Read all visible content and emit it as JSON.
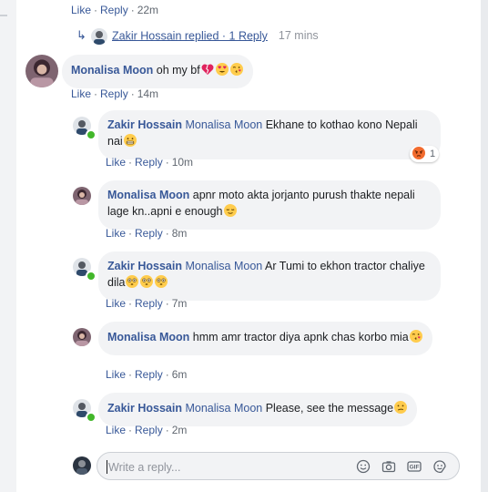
{
  "actions": {
    "like": "Like",
    "reply": "Reply",
    "sep": "·"
  },
  "top_row": {
    "time": "22m"
  },
  "reply_summary": {
    "text": "Zakir Hossain replied · 1 Reply",
    "time": "17 mins"
  },
  "comments": [
    {
      "id": "c1",
      "author": "Monalisa Moon",
      "mention": "",
      "text": "oh my bf",
      "time": "14m",
      "emojis": [
        "broken-heart",
        "heart-eyes",
        "kissing-face"
      ]
    },
    {
      "id": "r1",
      "author": "Zakir Hossain",
      "mention": "Monalisa Moon",
      "text": "Ekhane to kothao kono Nepali nai",
      "time": "10m",
      "emojis": [
        "grimacing-face"
      ],
      "reaction": {
        "icon": "angry-reaction",
        "count": "1"
      }
    },
    {
      "id": "r2",
      "author": "Monalisa Moon",
      "mention": "",
      "text": "apnr moto akta jorjanto purush thakte nepali lage kn..apni e enough",
      "time": "8m",
      "emojis": [
        "relieved-face"
      ]
    },
    {
      "id": "r3",
      "author": "Zakir Hossain",
      "mention": "Monalisa Moon",
      "text": "Ar Tumi to ekhon tractor chaliye dila",
      "time": "7m",
      "emojis": [
        "flushed-face",
        "flushed-face",
        "flushed-face"
      ]
    },
    {
      "id": "r4",
      "author": "Monalisa Moon",
      "mention": "",
      "text": "hmm amr tractor diya apnk chas korbo mia",
      "time": "6m",
      "emojis": [
        "kissing-face"
      ]
    },
    {
      "id": "r5",
      "author": "Zakir Hossain",
      "mention": "Monalisa Moon",
      "text": "Please, see the message",
      "time": "2m",
      "emojis": [
        "confused-face"
      ]
    }
  ],
  "composer": {
    "placeholder": "Write a reply...",
    "icons": [
      "smiley-icon",
      "camera-icon",
      "gif-icon",
      "sticker-icon"
    ]
  },
  "colors": {
    "link": "#385898",
    "meta": "#606770",
    "bubble": "#f2f3f5",
    "online": "#42b72a"
  }
}
